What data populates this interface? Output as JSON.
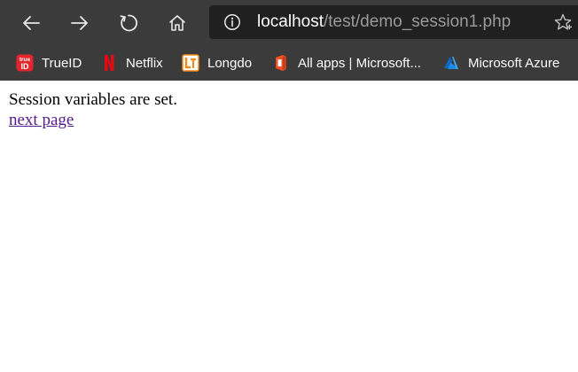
{
  "browser": {
    "address_bar": {
      "host": "localhost",
      "path": "/test/demo_session1.php"
    },
    "bookmarks": [
      {
        "label": "TrueID",
        "icon": "trueid-icon"
      },
      {
        "label": "Netflix",
        "icon": "netflix-icon"
      },
      {
        "label": "Longdo",
        "icon": "longdo-icon"
      },
      {
        "label": "All apps | Microsoft...",
        "icon": "microsoft-office-icon"
      },
      {
        "label": "Microsoft Azure",
        "icon": "azure-icon"
      }
    ],
    "icons": {
      "back": "back-arrow-icon",
      "forward": "forward-arrow-icon",
      "refresh": "refresh-icon",
      "home": "home-icon",
      "info": "info-icon",
      "favorite": "star-icon"
    }
  },
  "page": {
    "message": "Session variables are set.",
    "link_label": "next page"
  },
  "colors": {
    "chrome_bg": "#3b3b3b",
    "address_bg": "#202020",
    "visited_link": "#551a8b"
  }
}
